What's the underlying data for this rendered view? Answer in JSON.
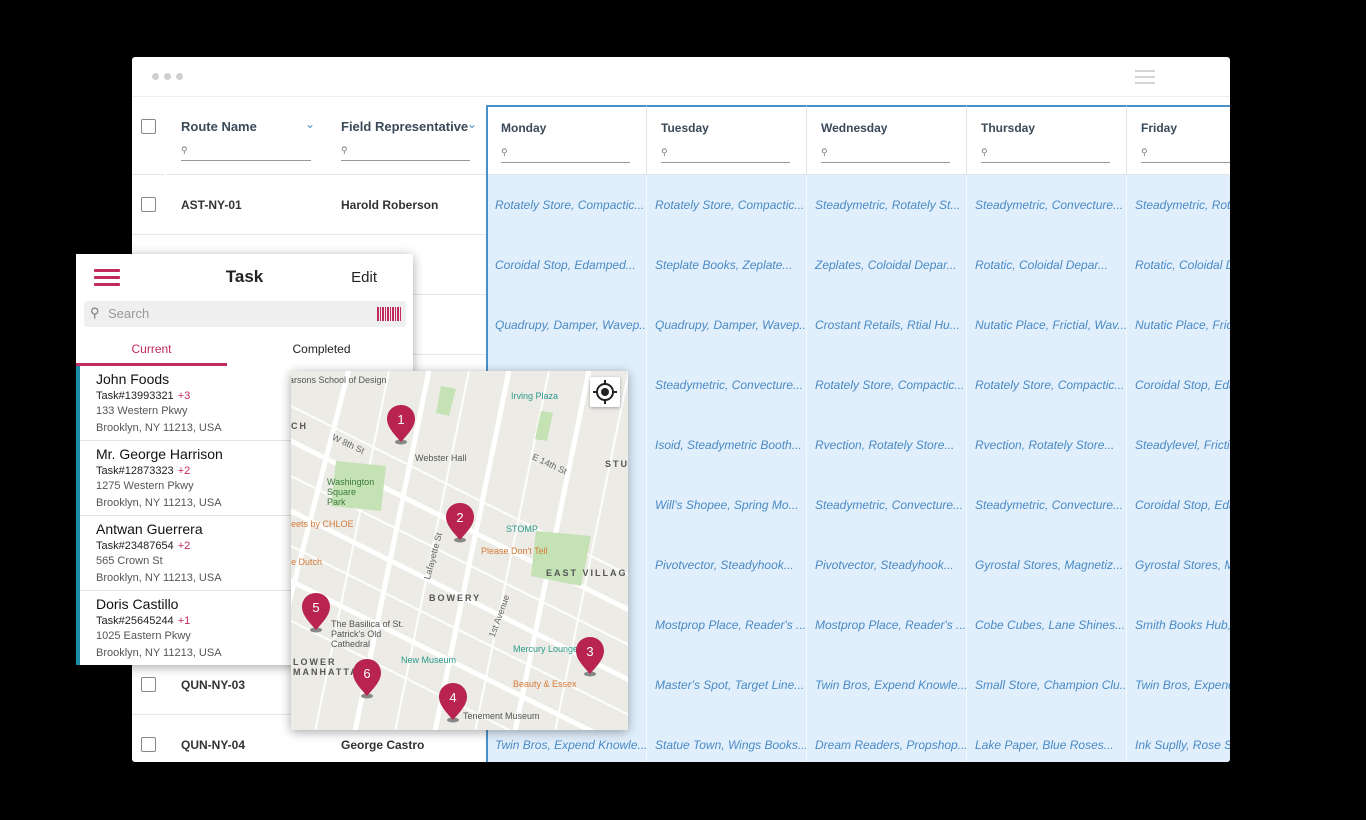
{
  "columns": {
    "route_name": "Route Name",
    "field_rep": "Field Representative",
    "days": [
      "Monday",
      "Tuesday",
      "Wednesday",
      "Thursday",
      "Friday"
    ]
  },
  "rows": [
    {
      "route": "AST-NY-01",
      "rep": "Harold Roberson",
      "days": [
        "Rotately Store, Compactic...",
        "Rotately Store, Compactic...",
        "Steadymetric, Rotately St...",
        "Steadymetric, Convecture...",
        "Steadymetric, Rota"
      ]
    },
    {
      "route": "",
      "rep": "",
      "days": [
        "Coroidal Stop, Edamped...",
        "Steplate Books, Zeplate...",
        "Zeplates, Coloidal Depar...",
        "Rotatic, Coloidal Depar...",
        "Rotatic, Coloidal D"
      ]
    },
    {
      "route": "",
      "rep": "",
      "days": [
        "Quadrupy, Damper, Wavep...",
        "Quadrupy, Damper, Wavep...",
        "Crostant Retails,  Rtial Hu...",
        "Nutatic Place, Frictial, Wav...",
        "Nutatic Place, Frict"
      ]
    },
    {
      "route": "",
      "rep": "",
      "days": [
        "",
        "Steadymetric, Convecture...",
        "Rotately Store, Compactic...",
        "Rotately Store, Compactic...",
        "Coroidal Stop, Edar"
      ]
    },
    {
      "route": "",
      "rep": "",
      "days": [
        "",
        "Isoid, Steadymetric Booth...",
        "Rvection, Rotately Store...",
        "Rvection, Rotately Store...",
        "Steadylevel, Frictin"
      ]
    },
    {
      "route": "",
      "rep": "",
      "days": [
        "",
        "Will's Shopee, Spring Mo...",
        "Steadymetric, Convecture...",
        "Steadymetric, Convecture...",
        "Coroidal Stop, Edar"
      ]
    },
    {
      "route": "",
      "rep": "",
      "days": [
        "",
        "Pivotvector, Steadyhook...",
        "Pivotvector, Steadyhook...",
        "Gyrostal Stores, Magnetiz...",
        "Gyrostal Stores, Ma"
      ]
    },
    {
      "route": "",
      "rep": "",
      "days": [
        "",
        "Mostprop Place, Reader's ...",
        "Mostprop Place, Reader's ...",
        "Cobe Cubes, Lane Shines...",
        "Smith Books Hub, I"
      ]
    },
    {
      "route": "QUN-NY-03",
      "rep": "",
      "days": [
        "",
        "Master's Spot, Target Line...",
        "Twin Bros, Expend Knowle...",
        "Small Store, Champion Clu...",
        "Twin Bros, Expend"
      ]
    },
    {
      "route": "QUN-NY-04",
      "rep": "George Castro",
      "days": [
        "Twin Bros, Expend Knowle...",
        "Statue Town, Wings Books...",
        "Dream Readers, Propshop...",
        "Lake Paper, Blue Roses...",
        "Ink Suplly, Rose Sto"
      ]
    }
  ],
  "task_panel": {
    "title": "Task",
    "edit": "Edit",
    "search_placeholder": "Search",
    "tabs": [
      "Current",
      "Completed"
    ],
    "items": [
      {
        "name": "John Foods",
        "task": "Task#13993321",
        "extra": "+3",
        "addr1": "133 Western Pkwy",
        "addr2": "Brooklyn, NY 11213, USA"
      },
      {
        "name": "Mr. George Harrison",
        "task": "Task#12873323",
        "extra": "+2",
        "addr1": "1275 Western Pkwy",
        "addr2": "Brooklyn, NY 11213, USA"
      },
      {
        "name": "Antwan Guerrera",
        "task": "Task#23487654",
        "extra": "+2",
        "addr1": "565 Crown St",
        "addr2": "Brooklyn, NY 11213, USA"
      },
      {
        "name": "Doris Castillo",
        "task": "Task#25645244",
        "extra": "+1",
        "addr1": "1025 Eastern Pkwy",
        "addr2": "Brooklyn, NY 11213, USA"
      }
    ]
  },
  "map": {
    "labels": [
      "arsons School of Design",
      "Irving Plaza",
      "Webster Hall",
      "W 8th St",
      "E 14th St",
      "Washington Square Park",
      "eets by CHLOE",
      "STU",
      "STOMP",
      "Please Don't Tell",
      "EAST VILLAGE",
      "e Dutch",
      "The Basilica of St. Patrick's Old Cathedral",
      "BOWERY",
      "New Museum",
      "Mercury Lounge",
      "Beauty & Essex",
      "Tenement Museum",
      "LOWER MANHATTAN",
      "Lafayette St",
      "1st Avenue",
      "CH"
    ],
    "pins": [
      "1",
      "2",
      "3",
      "4",
      "5",
      "6"
    ]
  },
  "colors": {
    "accent": "#c2295e",
    "cell_bg": "#e1effc",
    "cell_text": "#4a8ac4",
    "list_edge": "#1b8ca8"
  }
}
